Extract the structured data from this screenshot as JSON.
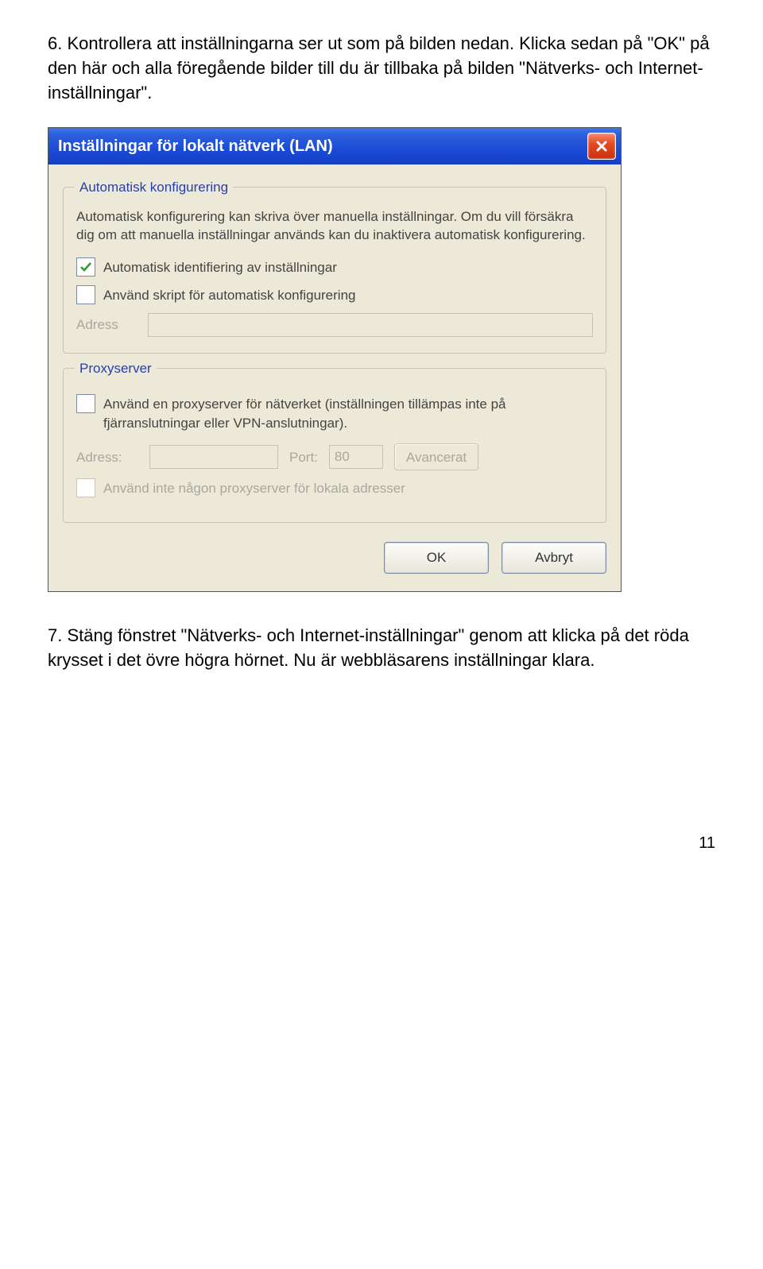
{
  "step6": "6. Kontrollera att inställningarna ser ut som på bilden nedan. Klicka sedan på \"OK\" på den här och alla föregående bilder till du är tillbaka på bilden \"Nätverks- och Internet-inställningar\".",
  "step7": "7. Stäng fönstret \"Nätverks- och Internet-inställningar\" genom att klicka på det röda krysset i det övre högra hörnet. Nu är webbläsarens inställningar klara.",
  "pageNumber": "11",
  "dialog": {
    "title": "Inställningar för lokalt nätverk (LAN)",
    "group1": {
      "title": "Automatisk konfigurering",
      "desc": "Automatisk konfigurering kan skriva över manuella inställningar. Om du vill försäkra dig om att manuella inställningar används kan du inaktivera automatisk konfigurering.",
      "cb1": "Automatisk identifiering av inställningar",
      "cb2": "Använd skript för automatisk konfigurering",
      "addressLabel": "Adress"
    },
    "group2": {
      "title": "Proxyserver",
      "cb": "Använd en proxyserver för nätverket (inställningen tillämpas inte på fjärranslutningar eller VPN-anslutningar).",
      "addressLabel": "Adress:",
      "portLabel": "Port:",
      "portValue": "80",
      "advanced": "Avancerat",
      "cbBypass": "Använd inte någon proxyserver för lokala adresser"
    },
    "ok": "OK",
    "cancel": "Avbryt"
  }
}
